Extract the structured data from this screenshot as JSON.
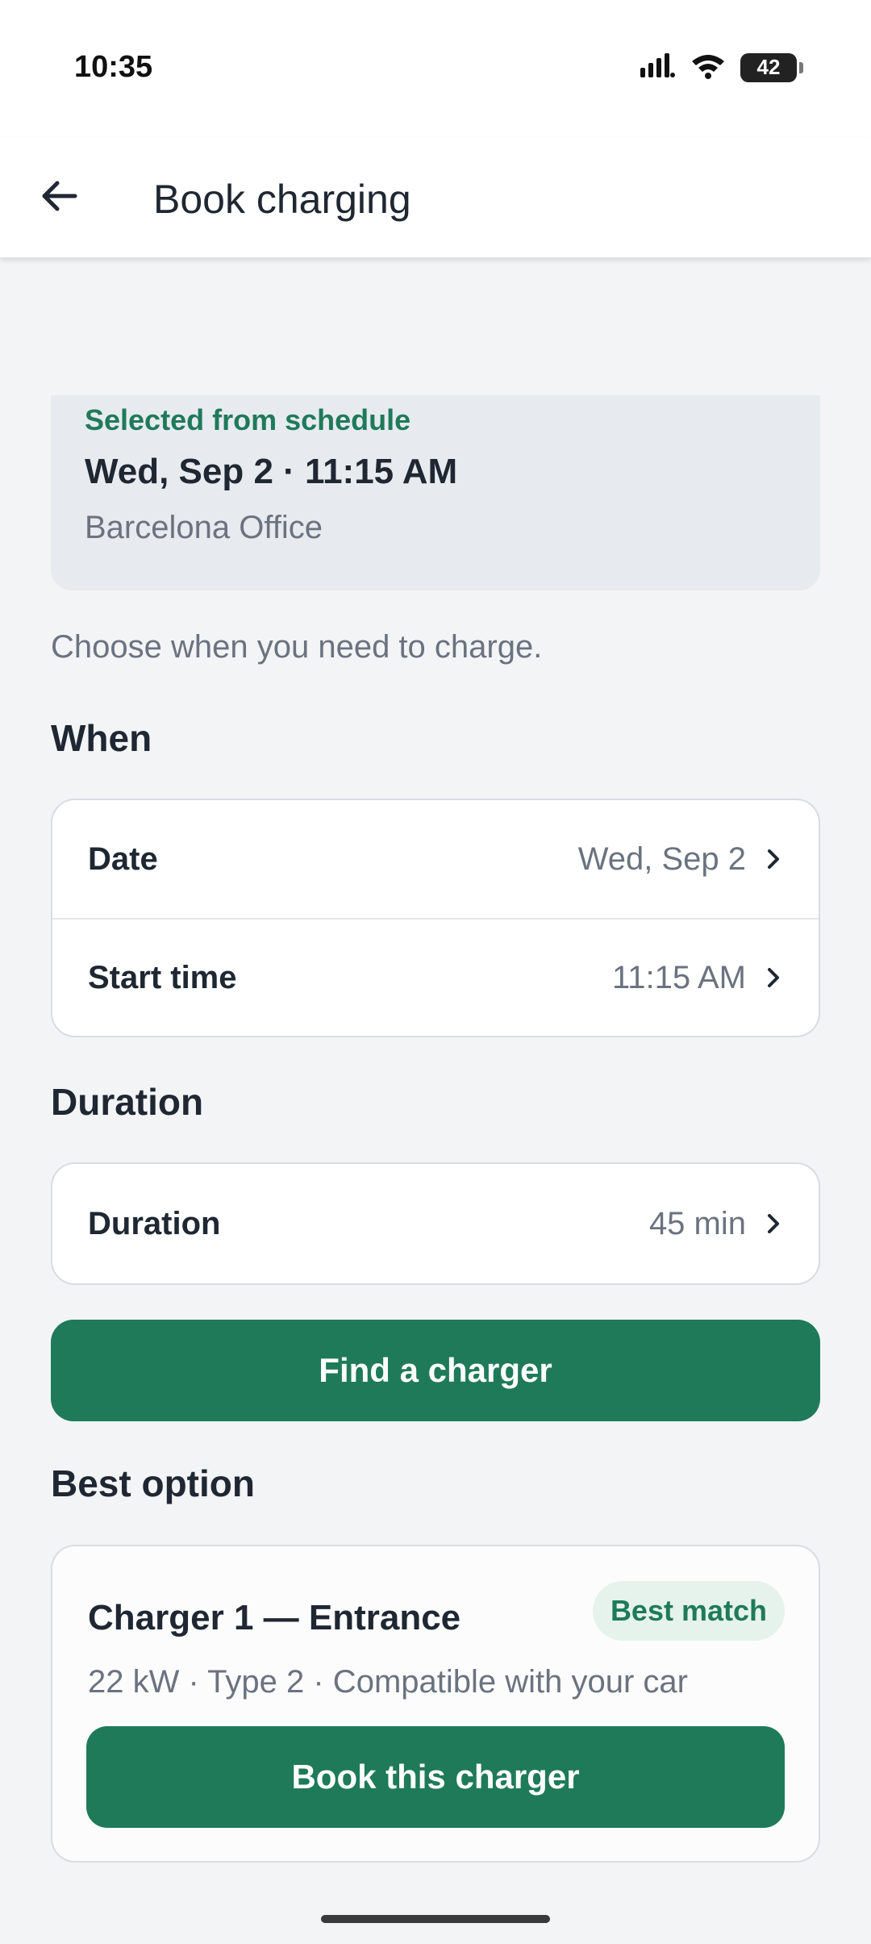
{
  "status_bar": {
    "time": "10:35",
    "battery_level": "42",
    "icons": [
      "signal-icon",
      "wifi-icon",
      "battery-icon"
    ]
  },
  "app_bar": {
    "back_icon": "arrow-left-icon",
    "title": "Book charging"
  },
  "schedule": {
    "kicker": "Selected from schedule",
    "datetime": "Wed, Sep 2 · 11:15 AM",
    "location": "Barcelona Office"
  },
  "intro": "Choose when you need to charge.",
  "when_section": {
    "heading": "When",
    "rows": [
      {
        "label": "Date",
        "value": "Wed, Sep 2"
      },
      {
        "label": "Start time",
        "value": "11:15 AM"
      }
    ]
  },
  "duration_section": {
    "heading": "Duration",
    "rows": [
      {
        "label": "Duration",
        "value": "45 min"
      }
    ]
  },
  "find_button": "Find a charger",
  "best_option": {
    "heading": "Best option",
    "title": "Charger 1 — Entrance",
    "badge": "Best match",
    "meta": "22 kW · Type 2 · Compatible with your car",
    "button": "Book this charger"
  },
  "colors": {
    "accent": "#1f7a5a",
    "background": "#f3f4f6",
    "card_highlight": "#e7ebef",
    "badge_bg": "#e6f3ec"
  }
}
